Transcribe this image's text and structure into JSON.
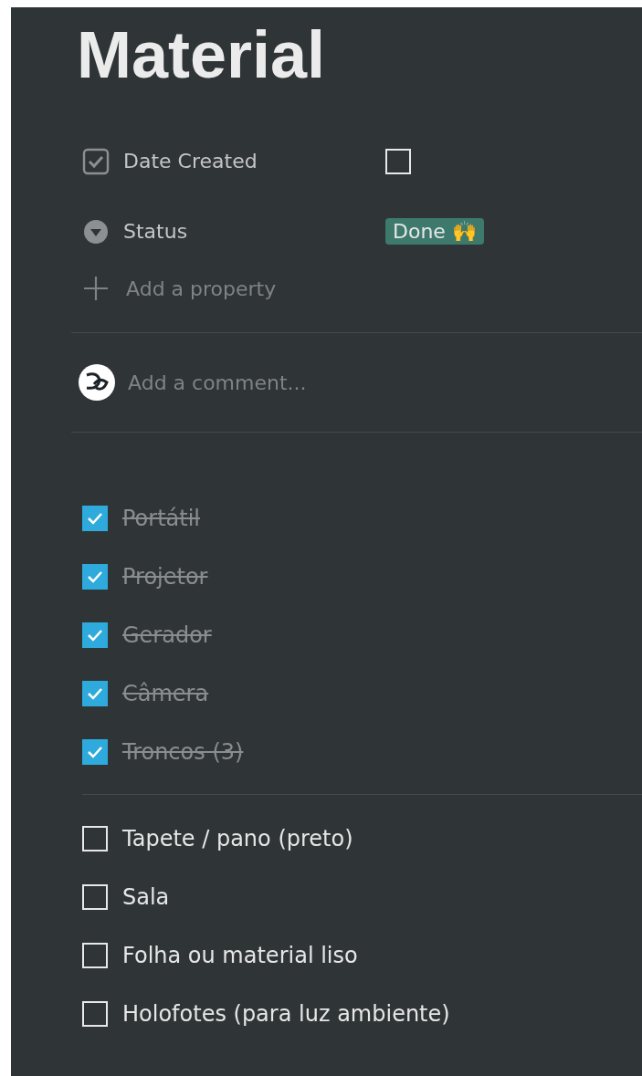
{
  "title": "Material",
  "properties": [
    {
      "kind": "checkbox",
      "label": "Date Created",
      "checked": false
    },
    {
      "kind": "select",
      "label": "Status",
      "value": "Done 🙌",
      "color": "#3d7a6d"
    }
  ],
  "add_property": "Add a property",
  "comment": {
    "placeholder": "Add a comment..."
  },
  "todo_groups": [
    {
      "items": [
        {
          "text": "Portátil",
          "checked": true
        },
        {
          "text": "Projetor",
          "checked": true
        },
        {
          "text": "Gerador",
          "checked": true
        },
        {
          "text": "Câmera",
          "checked": true
        },
        {
          "text": "Troncos (3)",
          "checked": true
        }
      ]
    },
    {
      "items": [
        {
          "text": "Tapete / pano (preto)",
          "checked": false
        },
        {
          "text": "Sala",
          "checked": false
        },
        {
          "text": "Folha ou material liso",
          "checked": false
        },
        {
          "text": "Holofotes (para luz ambiente)",
          "checked": false
        }
      ]
    }
  ]
}
